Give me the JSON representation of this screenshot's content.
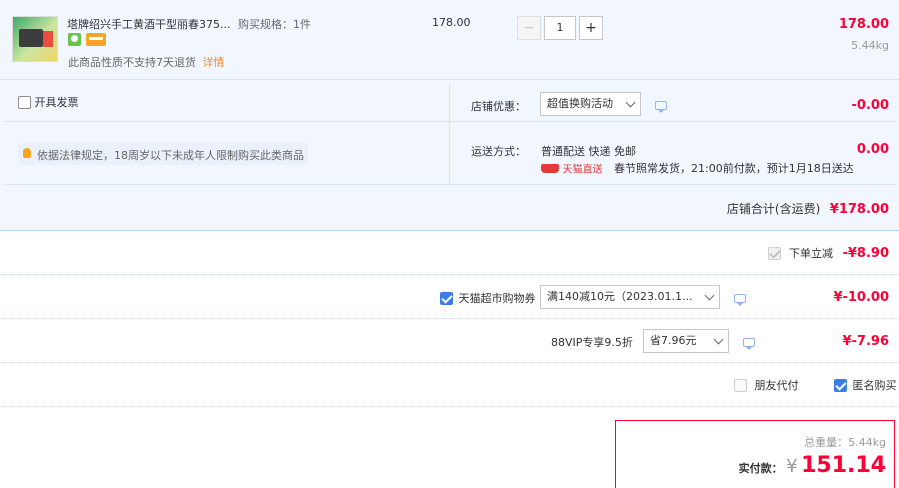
{
  "item": {
    "title": "塔牌绍兴手工黄酒干型丽春375...",
    "spec_label": "购买规格：",
    "spec_value": "1件",
    "notice": "此商品性质不支持7天退货",
    "details_link": "详情",
    "unit_price": "178.00",
    "quantity": "1",
    "subtotal": "178.00",
    "weight": "5.44kg",
    "decrement": "−",
    "increment": "+"
  },
  "invoice": {
    "label": "开具发票"
  },
  "store_discount": {
    "label": "店铺优惠：",
    "selected": "超值换购活动",
    "amount": "-0.00"
  },
  "law_notice": {
    "text": "依据法律规定，18周岁以下未成年人限制购买此类商品"
  },
  "shipping": {
    "label": "运送方式：",
    "method": "普通配送 快递 免邮",
    "carrier": "天猫直送",
    "note": "春节照常发货，21:00前付款，预计1月18日送达",
    "amount": "0.00"
  },
  "store_total": {
    "label": "店铺合计(含运费)",
    "amount": "¥178.00"
  },
  "discounts": {
    "instant": {
      "label": "下单立减",
      "amount": "-¥8.90"
    },
    "coupon": {
      "label": "天猫超市购物券",
      "selected": "满140减10元（2023.01.1...",
      "amount": "¥-10.00"
    },
    "vip": {
      "label": "88VIP专享9.5折",
      "selected": "省7.96元",
      "amount": "¥-7.96"
    }
  },
  "options": {
    "friend_pay": "朋友代付",
    "anonymous": "匿名购买"
  },
  "summary": {
    "weight_label": "总重量：5.44kg",
    "pay_label": "实付款：",
    "currency": "¥",
    "total": "151.14"
  },
  "colors": {
    "accent_red": "#ff0036",
    "blue_section": "#f2f7ff",
    "checkbox_blue": "#3b7de8",
    "tmall_red": "#e4393c"
  }
}
